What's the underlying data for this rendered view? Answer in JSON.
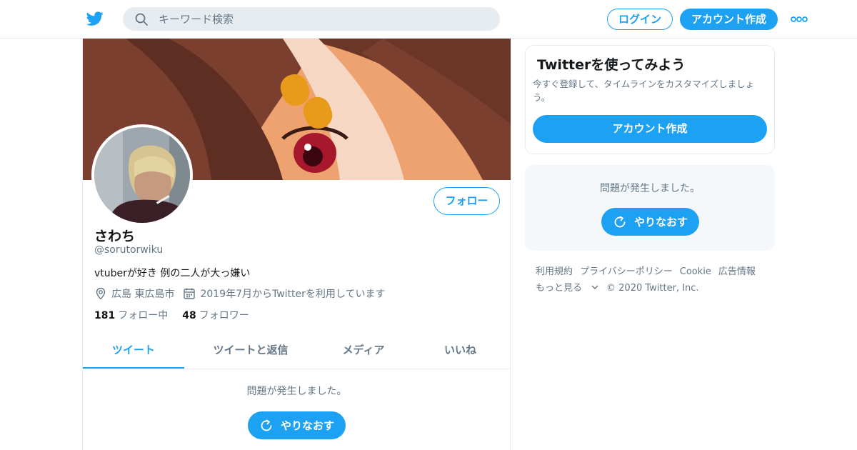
{
  "header": {
    "search_placeholder": "キーワード検索",
    "login_label": "ログイン",
    "signup_label": "アカウント作成",
    "brand_color": "#1da1f2"
  },
  "profile": {
    "follow_label": "フォロー",
    "name": "さわち",
    "handle": "@sorutorwiku",
    "bio": "vtuberが好き 例の二人が大っ嫌い",
    "location": "広島 東広島市",
    "joined": "2019年7月からTwitterを利用しています",
    "following_count": "181",
    "following_label": "フォロー中",
    "followers_count": "48",
    "followers_label": "フォロワー"
  },
  "tabs": [
    {
      "label": "ツイート",
      "active": true
    },
    {
      "label": "ツイートと返信",
      "active": false
    },
    {
      "label": "メディア",
      "active": false
    },
    {
      "label": "いいね",
      "active": false
    }
  ],
  "timeline": {
    "error_text": "問題が発生しました。",
    "retry_label": "やりなおす"
  },
  "sidebar": {
    "card_title": "Twitterを使ってみよう",
    "card_text": "今すぐ登録して、タイムラインをカスタマイズしましょう。",
    "card_button": "アカウント作成",
    "error_text": "問題が発生しました。",
    "retry_label": "やりなおす"
  },
  "footer": {
    "links": [
      "利用規約",
      "プライバシーポリシー",
      "Cookie",
      "広告情報"
    ],
    "more_label": "もっと見る",
    "copyright": "© 2020 Twitter, Inc."
  }
}
